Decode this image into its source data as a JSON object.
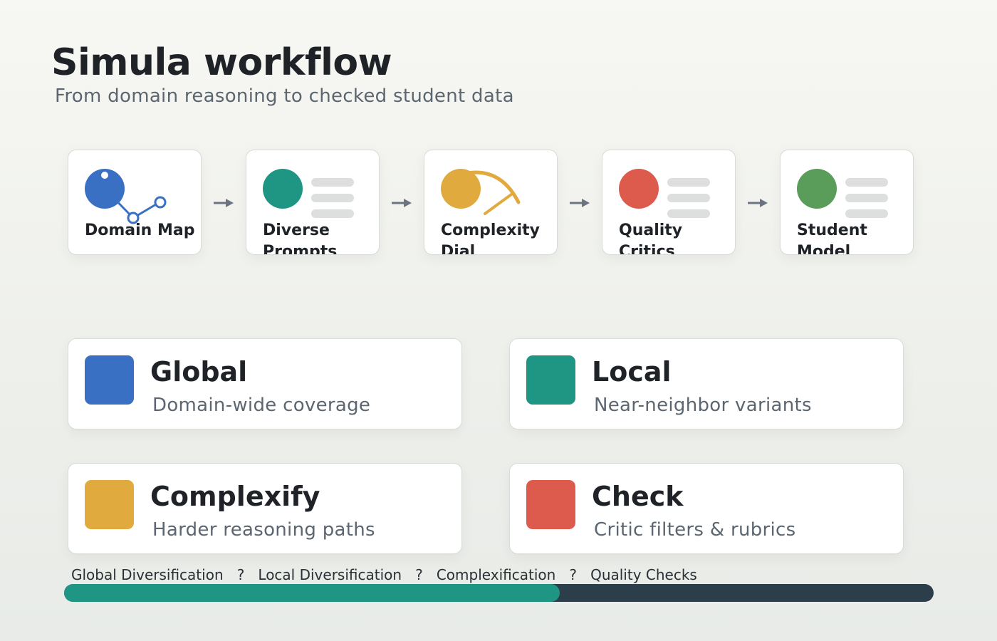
{
  "header": {
    "title": "Simula workflow",
    "subtitle": "From domain reasoning to checked student data"
  },
  "pipeline": {
    "steps": [
      {
        "label": "Domain Map",
        "icon": "domain-graph-icon",
        "color": "#3a70c4"
      },
      {
        "label": "Diverse Prompts",
        "icon": "prompt-lines-icon",
        "color": "#1f9583"
      },
      {
        "label": "Complexity Dial",
        "icon": "dial-gauge-icon",
        "color": "#e0aa3e"
      },
      {
        "label": "Quality Critics",
        "icon": "critic-lines-icon",
        "color": "#dc5b4d"
      },
      {
        "label": "Student Model",
        "icon": "model-lines-icon",
        "color": "#5a9c5a"
      }
    ],
    "arrow_icon": "arrow-right-icon"
  },
  "cards": [
    {
      "title": "Global",
      "desc": "Domain-wide coverage",
      "color": "#3a70c4"
    },
    {
      "title": "Local",
      "desc": "Near-neighbor variants",
      "color": "#1f9583"
    },
    {
      "title": "Complexify",
      "desc": "Harder reasoning paths",
      "color": "#e0aa3e"
    },
    {
      "title": "Check",
      "desc": "Critic filters & rubrics",
      "color": "#dc5b4d"
    }
  ],
  "stages": {
    "items": [
      "Global Diversification",
      "Local Diversification",
      "Complexification",
      "Quality Checks"
    ],
    "separator": "?"
  },
  "progress": {
    "fraction": 0.57,
    "fill_color": "#1f9583",
    "track_color": "#2c3e4a"
  }
}
